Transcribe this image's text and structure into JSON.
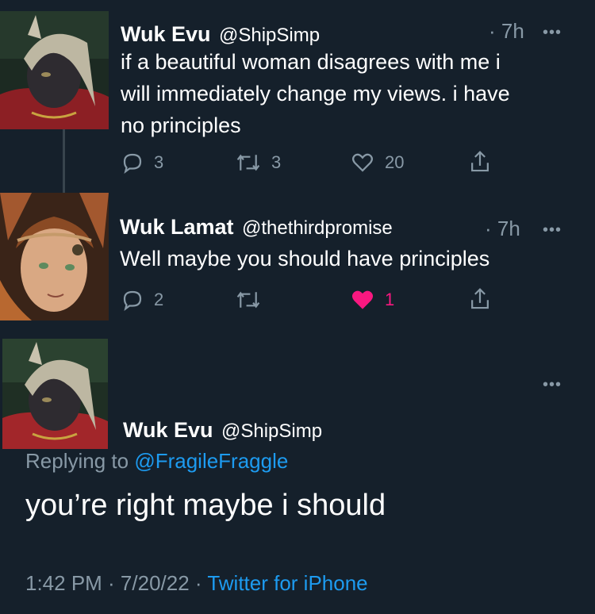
{
  "tweets": [
    {
      "name": "Wuk Evu",
      "handle": "@ShipSimp",
      "time": "· 7h",
      "more": "•••",
      "lines": [
        "if a beautiful woman disagrees with me i",
        "will immediately change my views. i have",
        "no principles"
      ],
      "replies": "3",
      "retweets": "3",
      "likes": "20"
    },
    {
      "name": "Wuk Lamat",
      "handle": "@thethirdpromise",
      "time": "· 7h",
      "more": "•••",
      "lines": [
        "Well maybe you should have principles"
      ],
      "replies": "2",
      "retweets": "",
      "likes": "1"
    }
  ],
  "detail": {
    "more": "•••",
    "name": "Wuk Evu",
    "handle": "@ShipSimp",
    "replying_prefix": "Replying to ",
    "replying_to": "@FragileFraggle",
    "text": "you’re right maybe i should",
    "timestamp": "1:42 PM · 7/20/22 · ",
    "source": "Twitter for iPhone"
  },
  "colors": {
    "background": "#15202b",
    "muted": "#8899a6",
    "link": "#1d9bf0",
    "like": "#f91880"
  },
  "icons": [
    "reply-icon",
    "retweet-icon",
    "like-icon",
    "share-icon",
    "more-icon"
  ]
}
